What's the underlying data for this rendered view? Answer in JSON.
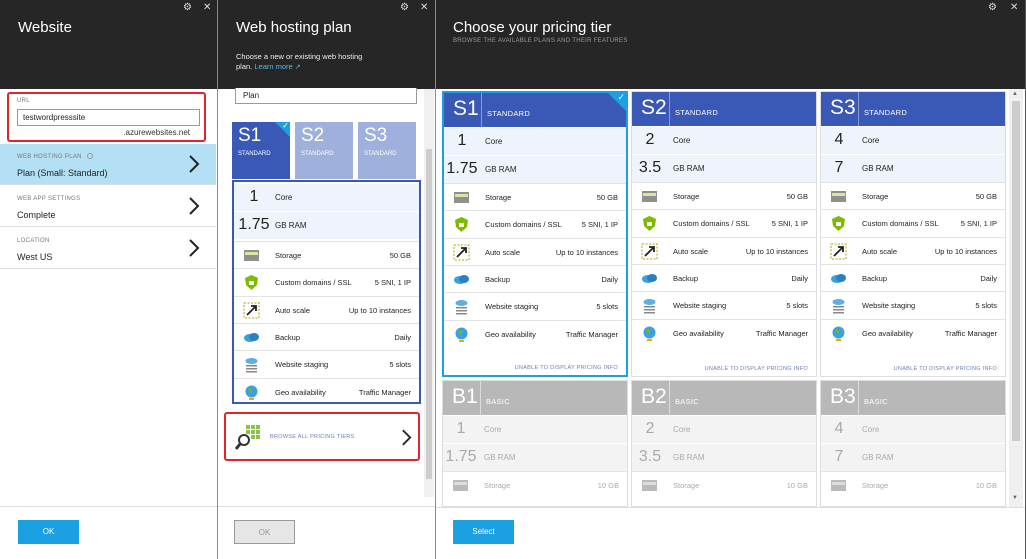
{
  "blade1": {
    "title": "Website",
    "url_label": "URL",
    "url_value": "testwordpresssite",
    "url_suffix": ".azurewebsites.net",
    "nav": [
      {
        "label": "WEB HOSTING PLAN",
        "value": "Plan (Small: Standard)"
      },
      {
        "label": "WEB APP SETTINGS",
        "value": "Complete"
      },
      {
        "label": "LOCATION",
        "value": "West US"
      }
    ],
    "ok_label": "OK"
  },
  "blade2": {
    "title": "Web hosting plan",
    "subtitle": "Choose a new or existing web hosting plan.",
    "learn_more": "Learn more",
    "plan_input": "Plan",
    "tabs": [
      {
        "code": "S1",
        "name": "STANDARD"
      },
      {
        "code": "S2",
        "name": "STANDARD"
      },
      {
        "code": "S3",
        "name": "STANDARD"
      }
    ],
    "core_num": "1",
    "core_label": "Core",
    "ram_num": "1.75",
    "ram_label": "GB RAM",
    "features": [
      {
        "icon": "storage-icon",
        "label": "Storage",
        "value": "50 GB"
      },
      {
        "icon": "ssl-shield-icon",
        "label": "Custom domains / SSL",
        "value": "5 SNI, 1 IP"
      },
      {
        "icon": "autoscale-icon",
        "label": "Auto scale",
        "value": "Up to 10 instances"
      },
      {
        "icon": "backup-cloud-icon",
        "label": "Backup",
        "value": "Daily"
      },
      {
        "icon": "staging-icon",
        "label": "Website staging",
        "value": "5 slots"
      },
      {
        "icon": "globe-icon",
        "label": "Geo availability",
        "value": "Traffic Manager"
      }
    ],
    "browse_label": "BROWSE ALL PRICING TIERS",
    "ok_label": "OK"
  },
  "blade3": {
    "title": "Choose your pricing tier",
    "subtitle": "BROWSE THE AVAILABLE PLANS AND THEIR FEATURES",
    "unable_label": "UNABLE TO DISPLAY PRICING INFO",
    "standard": [
      {
        "code": "S1",
        "name": "STANDARD",
        "core": "1",
        "core_label": "Core",
        "ram": "1.75",
        "ram_label": "GB RAM"
      },
      {
        "code": "S2",
        "name": "STANDARD",
        "core": "2",
        "core_label": "Core",
        "ram": "3.5",
        "ram_label": "GB RAM"
      },
      {
        "code": "S3",
        "name": "STANDARD",
        "core": "4",
        "core_label": "Core",
        "ram": "7",
        "ram_label": "GB RAM"
      }
    ],
    "features": [
      {
        "icon": "storage-icon",
        "label": "Storage",
        "value": "50 GB"
      },
      {
        "icon": "ssl-shield-icon",
        "label": "Custom domains / SSL",
        "value": "5 SNI, 1 IP"
      },
      {
        "icon": "autoscale-icon",
        "label": "Auto scale",
        "value": "Up to 10 instances"
      },
      {
        "icon": "backup-cloud-icon",
        "label": "Backup",
        "value": "Daily"
      },
      {
        "icon": "staging-icon",
        "label": "Website staging",
        "value": "5 slots"
      },
      {
        "icon": "globe-icon",
        "label": "Geo availability",
        "value": "Traffic Manager"
      }
    ],
    "basic": [
      {
        "code": "B1",
        "name": "BASIC",
        "core": "1",
        "core_label": "Core",
        "ram": "1.75",
        "ram_label": "GB RAM",
        "storage_label": "Storage",
        "storage_value": "10 GB"
      },
      {
        "code": "B2",
        "name": "BASIC",
        "core": "2",
        "core_label": "Core",
        "ram": "3.5",
        "ram_label": "GB RAM",
        "storage_label": "Storage",
        "storage_value": "10 GB"
      },
      {
        "code": "B3",
        "name": "BASIC",
        "core": "4",
        "core_label": "Core",
        "ram": "7",
        "ram_label": "GB RAM",
        "storage_label": "Storage",
        "storage_value": "10 GB"
      }
    ],
    "select_label": "Select"
  },
  "colors": {
    "header": "#262626",
    "accent": "#1ba1e2",
    "standard_tile": "#3a58b5",
    "standard_tile_light": "#9fb0dc",
    "basic_tile": "#b8b8b8",
    "highlight_red": "#e0262b",
    "selected_row": "#b3e0f5"
  }
}
